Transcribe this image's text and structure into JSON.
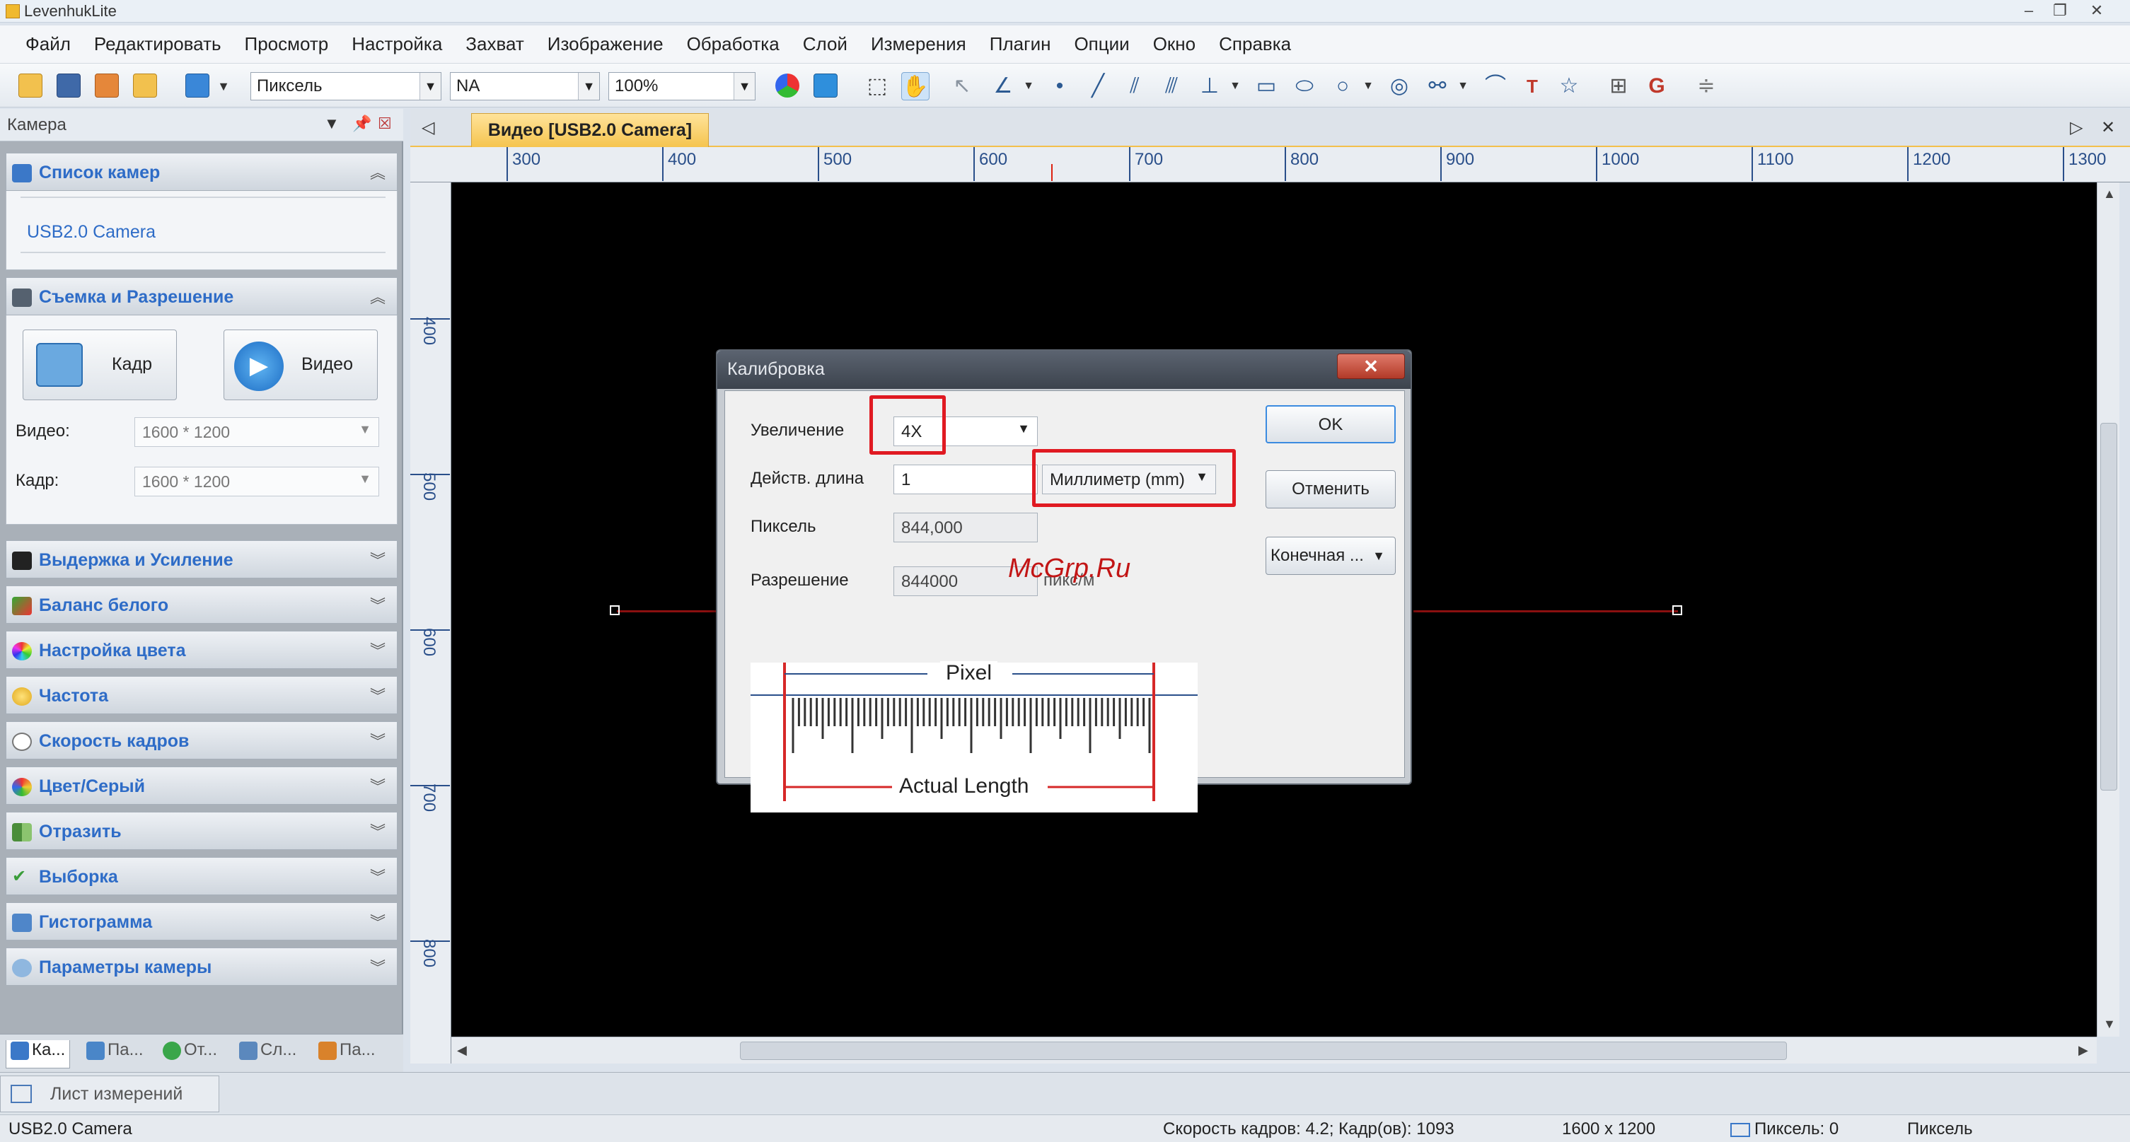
{
  "window": {
    "title": "LevenhukLite"
  },
  "menu": [
    "Файл",
    "Редактировать",
    "Просмотр",
    "Настройка",
    "Захват",
    "Изображение",
    "Обработка",
    "Слой",
    "Измерения",
    "Плагин",
    "Опции",
    "Окно",
    "Справка"
  ],
  "toolbar": {
    "unit_combo": "Пиксель",
    "na_combo": "NA",
    "zoom_combo": "100%"
  },
  "left_panel": {
    "title": "Камера",
    "camera_list": {
      "header": "Список камер",
      "items": [
        "USB2.0 Camera"
      ]
    },
    "capture": {
      "header": "Съемка и Разрешение",
      "snap_label": "Кадр",
      "video_label": "Видео",
      "video_field_label": "Видео:",
      "video_value": "1600 * 1200",
      "frame_field_label": "Кадр:",
      "frame_value": "1600 * 1200"
    },
    "sections": [
      "Выдержка и Усиление",
      "Баланс белого",
      "Настройка цвета",
      "Частота",
      "Скорость кадров",
      "Цвет/Серый",
      "Отразить",
      "Выборка",
      "Гистограмма",
      "Параметры камеры"
    ],
    "bottom_tabs": [
      "Ка...",
      "Па...",
      "От...",
      "Сл...",
      "Па..."
    ]
  },
  "document": {
    "tab": "Видео [USB2.0 Camera]",
    "ruler_h": [
      "300",
      "400",
      "500",
      "600",
      "700",
      "800",
      "900",
      "1000",
      "1100",
      "1200",
      "1300"
    ],
    "ruler_v": [
      "400",
      "500",
      "600",
      "700",
      "800"
    ]
  },
  "dialog": {
    "title": "Калибровка",
    "magnification_label": "Увеличение",
    "magnification_value": "4X",
    "actual_length_label": "Действ. длина",
    "actual_length_value": "1",
    "unit_value": "Миллиметр (mm)",
    "pixel_label": "Пиксель",
    "pixel_value": "844,000",
    "resolution_label": "Разрешение",
    "resolution_value": "844000",
    "resolution_unit": "пикс/м",
    "ok": "OK",
    "cancel": "Отменить",
    "final_combo": "Конечная ...",
    "figure_pixel": "Pixel",
    "figure_actual": "Actual Length",
    "watermark": "McGrp.Ru"
  },
  "sheet_tab": "Лист измерений",
  "status": {
    "camera": "USB2.0 Camera",
    "fps": "Скорость кадров: 4.2; Кадр(ов): 1093",
    "resolution": "1600 x 1200",
    "pixel": "Пиксель: 0",
    "unit": "Пиксель"
  }
}
